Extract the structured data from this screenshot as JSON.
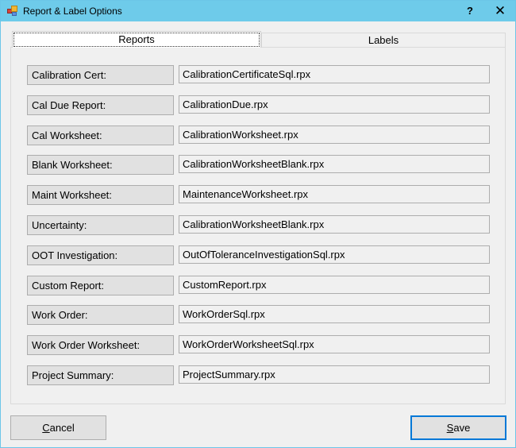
{
  "window": {
    "title": "Report & Label Options",
    "icon": "app-icon",
    "help_label": "?",
    "close_label": "✕"
  },
  "tabs": [
    {
      "label": "Reports",
      "selected": true
    },
    {
      "label": "Labels",
      "selected": false
    }
  ],
  "reports": [
    {
      "label": "Calibration Cert:",
      "value": "CalibrationCertificateSql.rpx"
    },
    {
      "label": "Cal Due Report:",
      "value": "CalibrationDue.rpx"
    },
    {
      "label": "Cal Worksheet:",
      "value": "CalibrationWorksheet.rpx"
    },
    {
      "label": "Blank Worksheet:",
      "value": "CalibrationWorksheetBlank.rpx"
    },
    {
      "label": "Maint Worksheet:",
      "value": "MaintenanceWorksheet.rpx"
    },
    {
      "label": "Uncertainty:",
      "value": "CalibrationWorksheetBlank.rpx"
    },
    {
      "label": "OOT Investigation:",
      "value": "OutOfToleranceInvestigationSql.rpx"
    },
    {
      "label": "Custom Report:",
      "value": "CustomReport.rpx"
    },
    {
      "label": "Work Order:",
      "value": "WorkOrderSql.rpx"
    },
    {
      "label": "Work Order Worksheet:",
      "value": "WorkOrderWorksheetSql.rpx"
    },
    {
      "label": "Project Summary:",
      "value": "ProjectSummary.rpx"
    }
  ],
  "buttons": {
    "cancel": {
      "mnemonic": "C",
      "rest": "ancel"
    },
    "save": {
      "mnemonic": "S",
      "rest": "ave"
    }
  },
  "colors": {
    "titlebar": "#6ecbea",
    "accent": "#0078d7"
  }
}
